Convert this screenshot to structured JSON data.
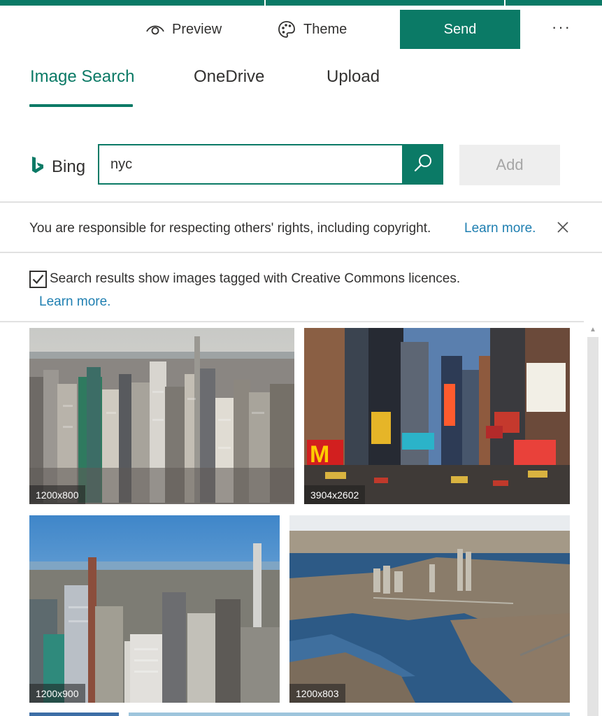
{
  "toolbar": {
    "preview_label": "Preview",
    "theme_label": "Theme",
    "send_label": "Send",
    "more_label": "···"
  },
  "tabs": [
    {
      "label": "Image Search",
      "active": true
    },
    {
      "label": "OneDrive",
      "active": false
    },
    {
      "label": "Upload",
      "active": false
    }
  ],
  "search": {
    "provider_label": "Bing",
    "query": "nyc",
    "add_label": "Add"
  },
  "notice": {
    "text": "You are responsible for respecting others' rights, including copyright.",
    "link": "Learn more."
  },
  "creative_commons": {
    "checked": true,
    "text": "Search results show images tagged with Creative Commons licences.",
    "link": "Learn more."
  },
  "results": [
    {
      "size": "1200x800",
      "icon": "nyc-skyline-image"
    },
    {
      "size": "3904x2602",
      "icon": "times-square-image"
    },
    {
      "size": "1200x900",
      "icon": "midtown-aerial-image"
    },
    {
      "size": "1200x803",
      "icon": "lower-manhattan-aerial-image"
    }
  ],
  "colors": {
    "accent": "#0b7a66",
    "link": "#1f7fb1"
  }
}
